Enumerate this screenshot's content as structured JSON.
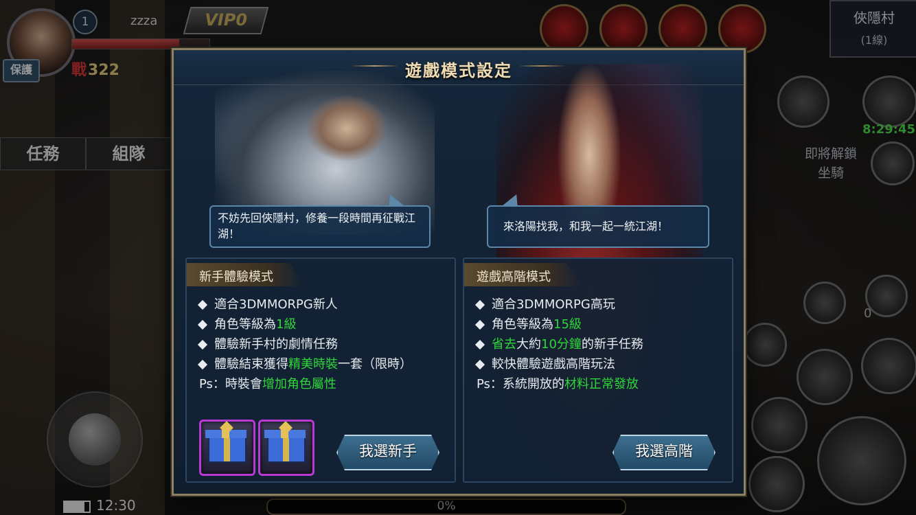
{
  "hud": {
    "player_level": "1",
    "player_name": "zzza",
    "vip_label": "VIP0",
    "protect_label": "保護",
    "power_glyph": "戰",
    "power_value": "322",
    "tab_task": "任務",
    "tab_team": "組隊",
    "time": "12:30",
    "bottom_progress": "0%",
    "location_name": "俠隱村",
    "location_line": "(1線)",
    "event_timer": "8:29:45",
    "unlock_line1": "即將解鎖",
    "unlock_line2": "坐騎",
    "zero_count": "0"
  },
  "dialog": {
    "title": "遊戲模式設定",
    "speech_left": "不妨先回俠隱村，修養一段時間再征戰江湖！",
    "speech_right": "來洛陽找我，和我一起一統江湖！",
    "novice": {
      "header": "新手體驗模式",
      "items": [
        {
          "pre": "適合3DMMORPG新人",
          "hl": "",
          "post": ""
        },
        {
          "pre": "角色等級為",
          "hl": "1級",
          "post": ""
        },
        {
          "pre": "體驗新手村的劇情任務",
          "hl": "",
          "post": ""
        },
        {
          "pre": "體驗結束獲得",
          "hl": "精美時裝",
          "post": "一套（限時）"
        }
      ],
      "ps_pre": "Ps：時裝會",
      "ps_hl": "增加角色屬性",
      "button": "我選新手"
    },
    "advanced": {
      "header": "遊戲高階模式",
      "items": [
        {
          "pre": "適合3DMMORPG高玩",
          "hl": "",
          "post": ""
        },
        {
          "pre": "角色等級為",
          "hl": "15級",
          "post": ""
        },
        {
          "pre": "",
          "hl": "省去",
          "post": "大約"
        },
        {
          "pre": "較快體驗遊戲高階玩法",
          "hl": "",
          "post": ""
        }
      ],
      "item3_hl2": "10分鐘",
      "item3_post2": "的新手任務",
      "ps_pre": "Ps：系統開放的",
      "ps_hl": "材料正常發放",
      "button": "我選高階"
    }
  },
  "colors": {
    "highlight": "#2fd63a",
    "title": "#f2ddb2",
    "gift_border": "#b93ad3"
  }
}
